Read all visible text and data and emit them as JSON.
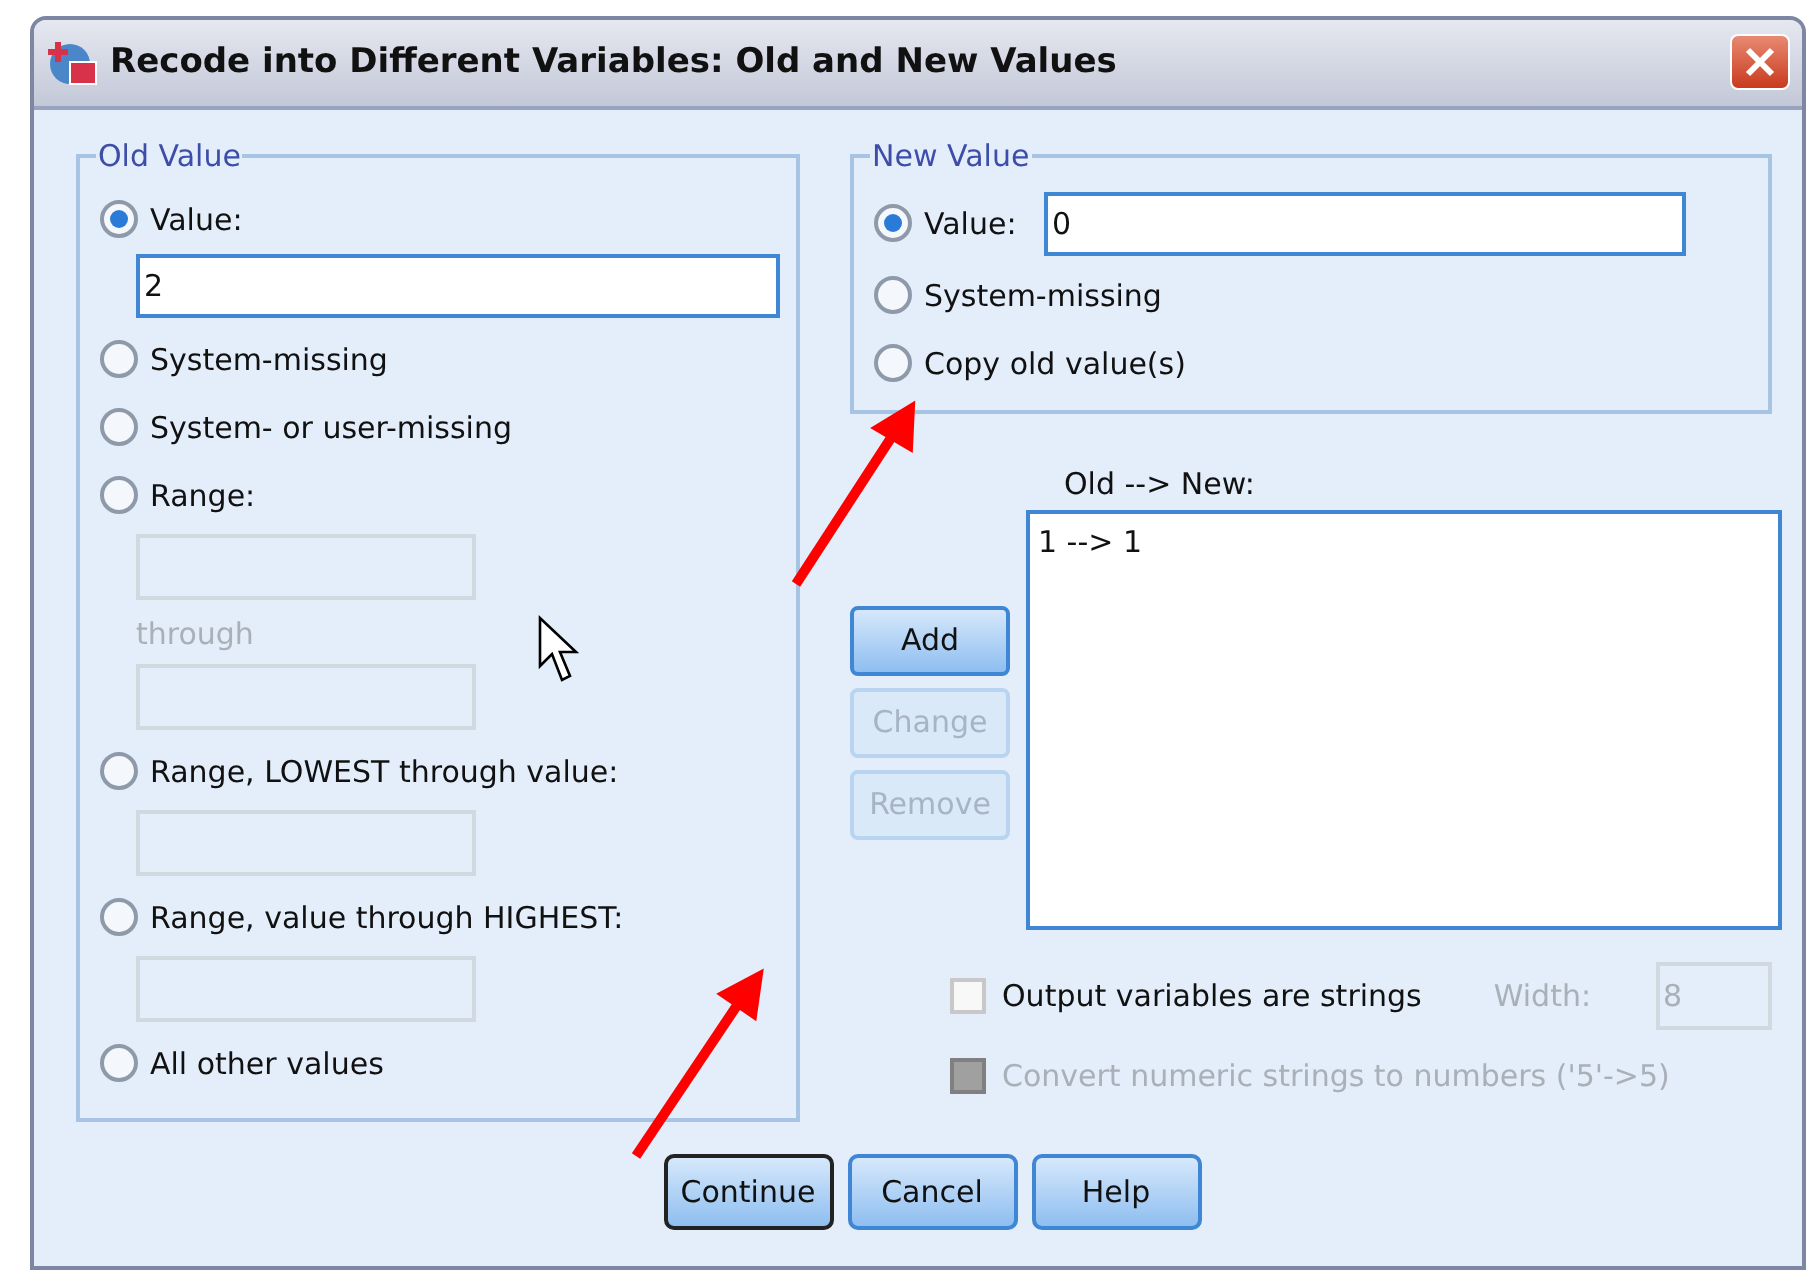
{
  "window": {
    "title": "Recode into Different Variables: Old and New Values"
  },
  "old_value": {
    "title": "Old Value",
    "options": [
      {
        "kind": "value",
        "label": "Value:",
        "selected": true,
        "value": "2"
      },
      {
        "kind": "plain",
        "label": "System-missing",
        "selected": false
      },
      {
        "kind": "plain",
        "label": "System- or user-missing",
        "selected": false
      },
      {
        "kind": "range",
        "label": "Range:",
        "selected": false,
        "through": "through"
      },
      {
        "kind": "single",
        "label": "Range, LOWEST through value:",
        "selected": false
      },
      {
        "kind": "single",
        "label": "Range, value through HIGHEST:",
        "selected": false
      },
      {
        "kind": "plain",
        "label": "All other values",
        "selected": false
      }
    ]
  },
  "new_value": {
    "title": "New Value",
    "options": [
      {
        "kind": "value",
        "label": "Value:",
        "selected": true,
        "value": "0"
      },
      {
        "kind": "plain",
        "label": "System-missing",
        "selected": false
      },
      {
        "kind": "plain",
        "label": "Copy old value(s)",
        "selected": false
      }
    ]
  },
  "mapping": {
    "label": "Old --> New:",
    "items": [
      "1 --> 1"
    ]
  },
  "mapping_buttons": [
    {
      "label": "Add",
      "disabled": false
    },
    {
      "label": "Change",
      "disabled": true
    },
    {
      "label": "Remove",
      "disabled": true
    }
  ],
  "options": [
    {
      "label": "Output variables are strings",
      "checked": false,
      "disabled": false
    },
    {
      "label": "Convert numeric strings to numbers ('5'->5)",
      "checked": false,
      "disabled": true
    }
  ],
  "width": {
    "label": "Width:",
    "value": "8",
    "disabled": true
  },
  "footer_buttons": [
    {
      "label": "Continue",
      "default": true
    },
    {
      "label": "Cancel",
      "default": false
    },
    {
      "label": "Help",
      "default": false
    }
  ]
}
